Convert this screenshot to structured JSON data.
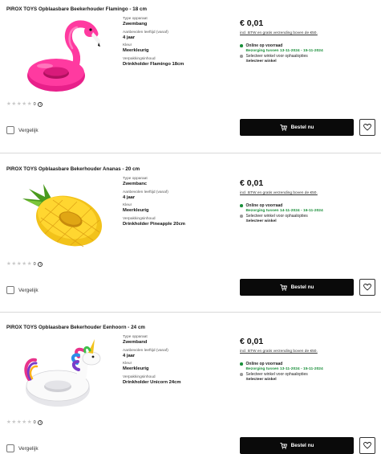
{
  "products": [
    {
      "title": "PIROX TOYS Opblaasbare Beekerhouder Flamingo - 18 cm",
      "image_icon": "flamingo-float-image",
      "specs": [
        {
          "label": "Type opparaat",
          "value": "Zwembang"
        },
        {
          "label": "Aanbevolen leeftijd (vanaf)",
          "value": "4 jaar"
        },
        {
          "label": "Kleur",
          "value": "Meerkleurig"
        },
        {
          "label": "Verpakkingsinhoud",
          "value": "Drinkholder Flamingo 18cm"
        }
      ],
      "price": "€ 0,01",
      "price_note": "incl. BTW en gratis verzending boven de €50.",
      "availability": {
        "online": "Online op voorraad",
        "delivery": "Bezorging tussen 13-11-2024 - 15-11-2024",
        "store": "Selecteer winkel voor ophaalopties",
        "store_sub": "Selecteer winkel"
      },
      "rating_count": "0",
      "compare_label": "Vergelijk",
      "order_label": "Bestel nu"
    },
    {
      "title": "PIROX TOYS Opblaasbare Bekerhouder Ananas - 20 cm",
      "image_icon": "pineapple-float-image",
      "specs": [
        {
          "label": "Type opparaat",
          "value": "Zwembanc"
        },
        {
          "label": "Aanbevolen leeftijd (vanaf)",
          "value": "4 jaar"
        },
        {
          "label": "Kleur",
          "value": "Meerkleurig"
        },
        {
          "label": "Verpakkingsinhoud",
          "value": "Drinkholder Pineapple 20cm"
        }
      ],
      "price": "€ 0,01",
      "price_note": "incl. BTW en gratis verzending boven de €50.",
      "availability": {
        "online": "Online op voorraad",
        "delivery": "Bezorging tussen 14-11-2024 - 16-11-2024",
        "store": "Selecteer winkel voor ophaalopties",
        "store_sub": "Selecteer winkel"
      },
      "rating_count": "0",
      "compare_label": "Vergelijk",
      "order_label": "Bestel nu"
    },
    {
      "title": "PIROX TOYS Opblaasbare Bekerhouder Eenhoorn - 24 cm",
      "image_icon": "unicorn-float-image",
      "specs": [
        {
          "label": "Type opparaat",
          "value": "Zwemband"
        },
        {
          "label": "Aanbevolen leeftijd (vanaf)",
          "value": "4 jaar"
        },
        {
          "label": "Kleur",
          "value": "Meerkleurig"
        },
        {
          "label": "Verpakkingsinhoud",
          "value": "Drinkholder Unicorn 24cm"
        }
      ],
      "price": "€ 0,01",
      "price_note": "incl. BTW en gratis verzending boven de €50.",
      "availability": {
        "online": "Online op voorraad",
        "delivery": "Bezorging tussen 13-11-2024 - 15-11-2024",
        "store": "Selecteer winkel voor ophaalopties",
        "store_sub": "Selecteer winkel"
      },
      "rating_count": "0",
      "compare_label": "Vergelijk",
      "order_label": "Bestel nu"
    }
  ],
  "icons": {
    "cart": "cart-icon",
    "wishlist": "heart-icon",
    "star": "star-icon",
    "info": "info-icon"
  },
  "colors": {
    "button_bg": "#0a0a0a",
    "availability_green": "#1a8f3a",
    "divider": "#d9d9d9"
  }
}
